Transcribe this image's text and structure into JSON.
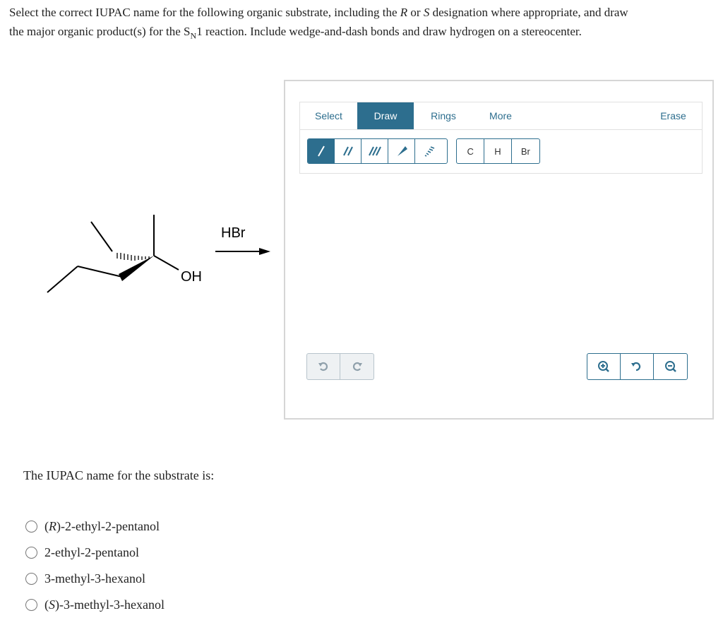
{
  "question": {
    "line1_before_r": "Select the correct IUPAC name for the following organic substrate, including the ",
    "r": "R",
    "or": " or ",
    "s": "S",
    "line1_after_s": " designation where appropriate, and draw",
    "line2_before_sn": "the major organic product(s) for the S",
    "sn_sub": "N",
    "line2_after_sn": "1 reaction. Include wedge-and-dash bonds and draw hydrogen on a stereocenter."
  },
  "reaction": {
    "reagent": "HBr",
    "oh_label": "OH"
  },
  "editor": {
    "tabs": [
      {
        "label": "Select",
        "active": false
      },
      {
        "label": "Draw",
        "active": true
      },
      {
        "label": "Rings",
        "active": false
      },
      {
        "label": "More",
        "active": false
      },
      {
        "label": "Erase",
        "active": false
      }
    ],
    "bond_tools": [
      "single-bond",
      "double-bond",
      "triple-bond",
      "wedge-bond",
      "dash-bond"
    ],
    "atoms": [
      "C",
      "H",
      "Br"
    ],
    "accent_color": "#2d6e8e"
  },
  "iupac": {
    "label": "The IUPAC name for the substrate is:",
    "options": [
      {
        "prefix": "(",
        "stereo": "R",
        "suffix": ")-2-ethyl-2-pentanol"
      },
      {
        "prefix": "",
        "stereo": "",
        "suffix": "2-ethyl-2-pentanol"
      },
      {
        "prefix": "",
        "stereo": "",
        "suffix": "3-methyl-3-hexanol"
      },
      {
        "prefix": "(",
        "stereo": "S",
        "suffix": ")-3-methyl-3-hexanol"
      }
    ]
  }
}
